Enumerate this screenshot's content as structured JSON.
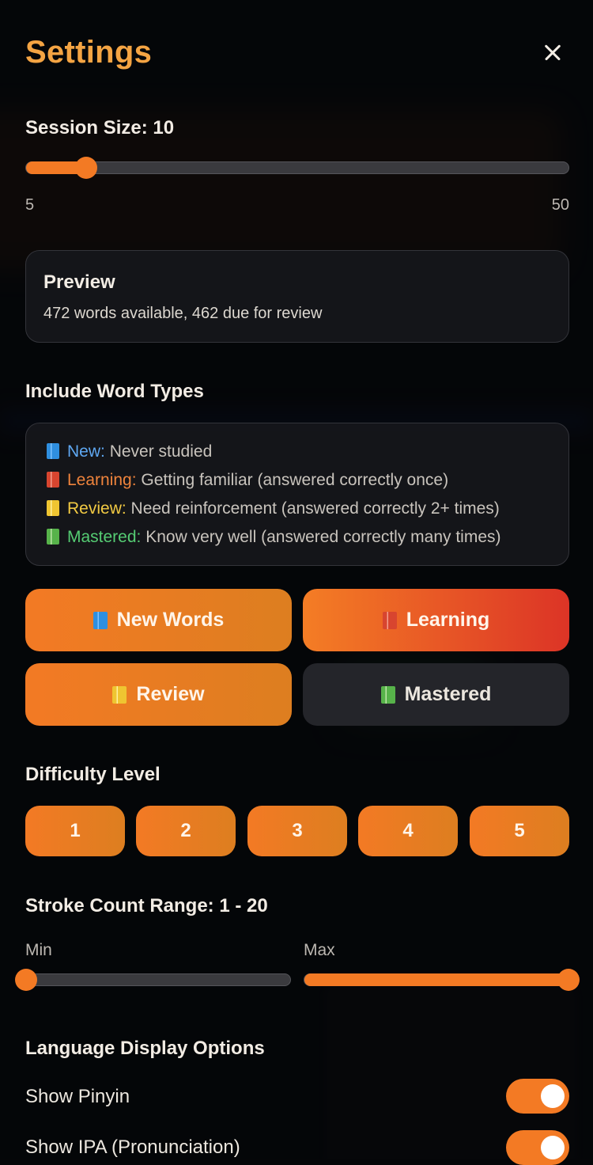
{
  "header": {
    "title": "Settings"
  },
  "session": {
    "label": "Session Size:",
    "value": "10",
    "min_label": "5",
    "max_label": "50",
    "level": 0.111
  },
  "preview": {
    "title": "Preview",
    "text": "472 words available, 462 due for review"
  },
  "word_types": {
    "heading": "Include Word Types",
    "legend": [
      {
        "icon": "blue-book-icon",
        "name": "New:",
        "desc": " Never studied",
        "color": "#5fa8f2"
      },
      {
        "icon": "red-book-icon",
        "name": "Learning:",
        "desc": " Getting familiar (answered correctly once)",
        "color": "#f0843c"
      },
      {
        "icon": "yellow-notebook-icon",
        "name": "Review:",
        "desc": " Need reinforcement (answered correctly 2+ times)",
        "color": "#f2ca43"
      },
      {
        "icon": "green-book-icon",
        "name": "Mastered:",
        "desc": " Know very well (answered correctly many times)",
        "color": "#55cc73"
      }
    ],
    "buttons": [
      {
        "label": "New Words",
        "icon": "blue-book-icon",
        "selected": true
      },
      {
        "label": "Learning",
        "icon": "red-book-icon",
        "selected": true
      },
      {
        "label": "Review",
        "icon": "yellow-notebook-icon",
        "selected": true
      },
      {
        "label": "Mastered",
        "icon": "green-book-icon",
        "selected": false
      }
    ]
  },
  "difficulty": {
    "heading": "Difficulty Level",
    "levels": [
      "1",
      "2",
      "3",
      "4",
      "5"
    ]
  },
  "stroke": {
    "label": "Stroke Count Range:",
    "range": "1 - 20",
    "min_label": "Min",
    "max_label": "Max",
    "min_level": 0.0,
    "max_level": 1.0
  },
  "language": {
    "heading": "Language Display Options",
    "options": [
      {
        "label": "Show Pinyin",
        "on": true
      },
      {
        "label": "Show IPA (Pronunciation)",
        "on": true
      }
    ]
  },
  "colors": {
    "accent": "#f37a24",
    "title": "#f4a443",
    "background": "#050608"
  }
}
